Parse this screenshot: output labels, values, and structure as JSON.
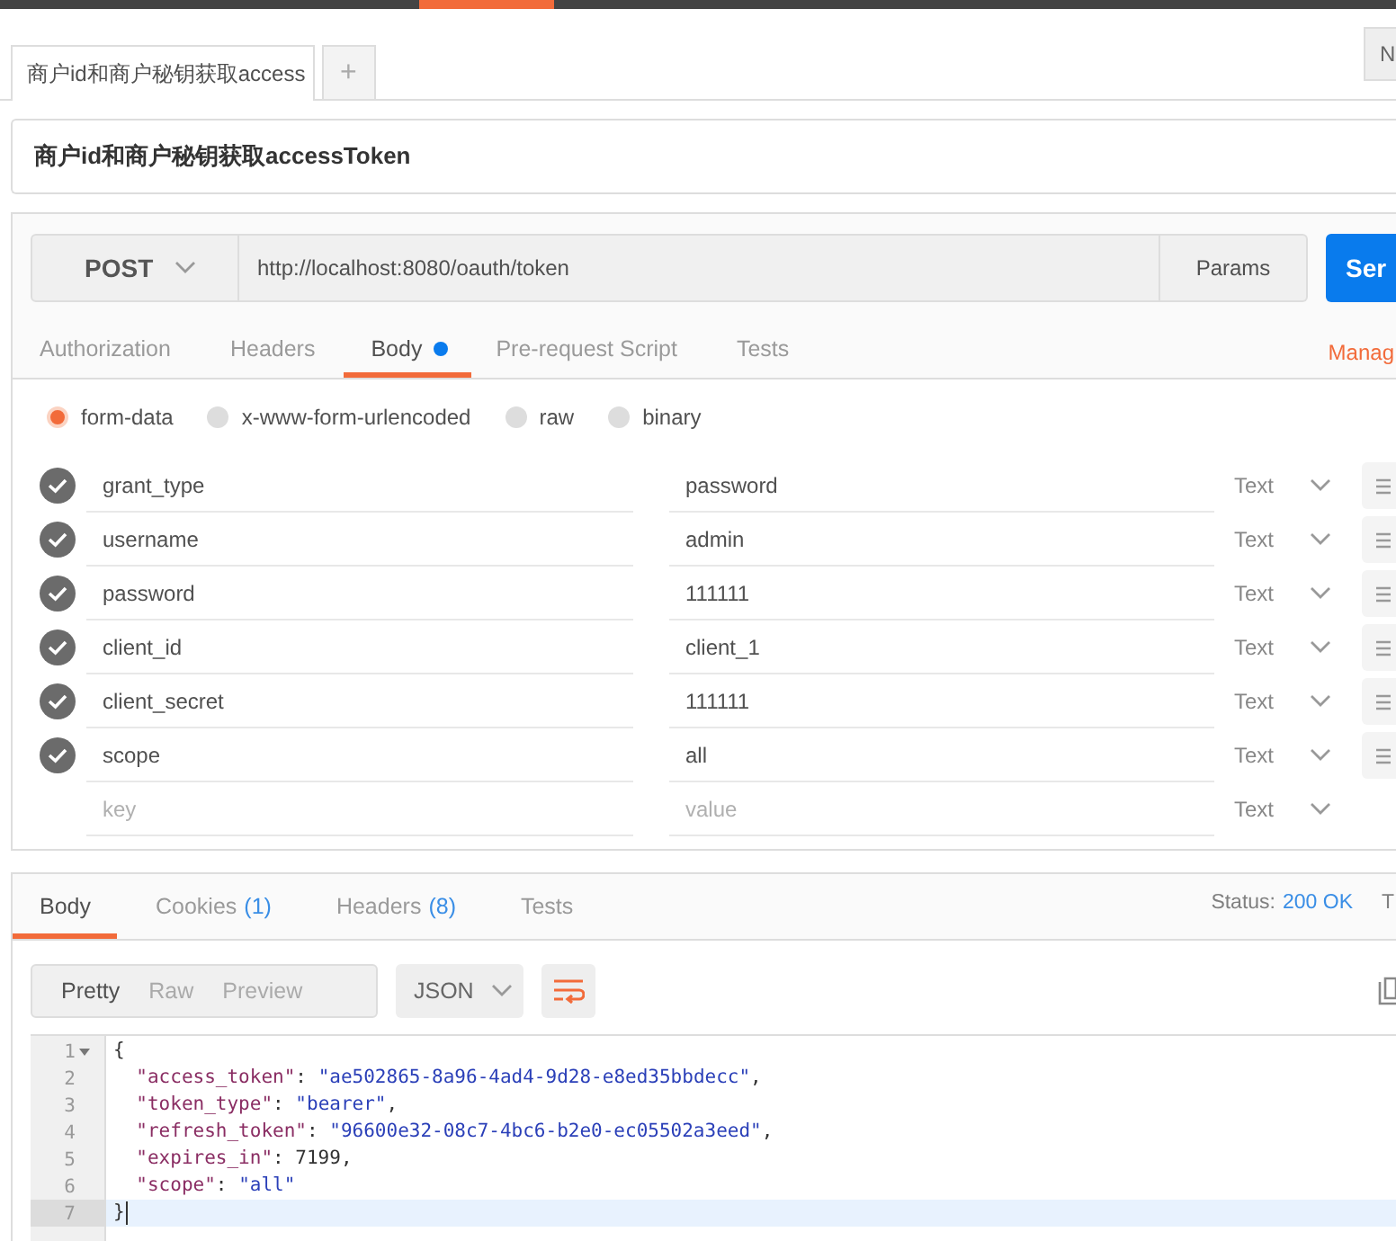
{
  "tabs": [
    {
      "label": "商户id和商户秘钥获取access",
      "selected": true,
      "kind": "request"
    },
    {
      "label": "+",
      "selected": false,
      "kind": "add"
    }
  ],
  "corner_button": "N",
  "request": {
    "name": "商户id和商户秘钥获取accessToken",
    "method": "POST",
    "url": "http://localhost:8080/oauth/token",
    "params_button": "Params",
    "send_button": "Ser",
    "tabs": [
      {
        "label": "Authorization",
        "selected": false,
        "dot": false
      },
      {
        "label": "Headers",
        "selected": false,
        "dot": false
      },
      {
        "label": "Body",
        "selected": true,
        "dot": true
      },
      {
        "label": "Pre-request Script",
        "selected": false,
        "dot": false
      },
      {
        "label": "Tests",
        "selected": false,
        "dot": false
      }
    ],
    "manage_link": "Manag",
    "body_modes": [
      {
        "label": "form-data",
        "selected": true
      },
      {
        "label": "x-www-form-urlencoded",
        "selected": false
      },
      {
        "label": "raw",
        "selected": false
      },
      {
        "label": "binary",
        "selected": false
      }
    ],
    "params": [
      {
        "key": "grant_type",
        "value": "password",
        "type": "Text",
        "enabled": true
      },
      {
        "key": "username",
        "value": "admin",
        "type": "Text",
        "enabled": true
      },
      {
        "key": "password",
        "value": "111111",
        "type": "Text",
        "enabled": true
      },
      {
        "key": "client_id",
        "value": "client_1",
        "type": "Text",
        "enabled": true
      },
      {
        "key": "client_secret",
        "value": "111111",
        "type": "Text",
        "enabled": true
      },
      {
        "key": "scope",
        "value": "all",
        "type": "Text",
        "enabled": true
      }
    ],
    "new_param": {
      "key_placeholder": "key",
      "value_placeholder": "value",
      "type": "Text"
    }
  },
  "response": {
    "tabs": [
      {
        "label": "Body",
        "selected": true
      },
      {
        "label": "Cookies",
        "count": "(1)",
        "selected": false
      },
      {
        "label": "Headers",
        "count": "(8)",
        "selected": false
      },
      {
        "label": "Tests",
        "selected": false
      }
    ],
    "status_label": "Status:",
    "status": "200 OK",
    "time_label": "T",
    "view_modes": [
      {
        "label": "Pretty",
        "selected": true
      },
      {
        "label": "Raw",
        "selected": false
      },
      {
        "label": "Preview",
        "selected": false
      }
    ],
    "format": "JSON",
    "code_lines": [
      {
        "number": "1",
        "text": "{",
        "foldable": true,
        "highlighted": false
      },
      {
        "number": "2",
        "text": "  \"access_token\": \"ae502865-8a96-4ad4-9d28-e8ed35bbdecc\",",
        "foldable": false,
        "highlighted": false
      },
      {
        "number": "3",
        "text": "  \"token_type\": \"bearer\",",
        "foldable": false,
        "highlighted": false
      },
      {
        "number": "4",
        "text": "  \"refresh_token\": \"96600e32-08c7-4bc6-b2e0-ec05502a3eed\",",
        "foldable": false,
        "highlighted": false
      },
      {
        "number": "5",
        "text": "  \"expires_in\": 7199,",
        "foldable": false,
        "highlighted": false
      },
      {
        "number": "6",
        "text": "  \"scope\": \"all\"",
        "foldable": false,
        "highlighted": false
      },
      {
        "number": "7",
        "text": "}",
        "foldable": false,
        "highlighted": true
      }
    ]
  }
}
